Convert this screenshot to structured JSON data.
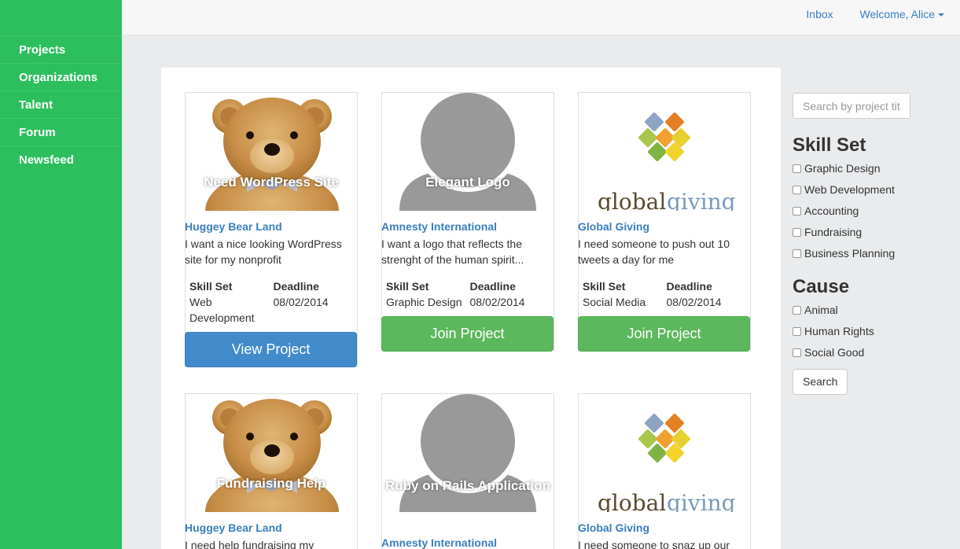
{
  "nav": {
    "items": [
      {
        "label": "Projects"
      },
      {
        "label": "Organizations"
      },
      {
        "label": "Talent"
      },
      {
        "label": "Forum"
      },
      {
        "label": "Newsfeed"
      }
    ]
  },
  "topbar": {
    "inbox": "Inbox",
    "welcome": "Welcome, Alice"
  },
  "projects": [
    {
      "title": "Need WordPress Site",
      "org": "Huggey Bear Land",
      "desc": "I want a nice looking WordPress site for my nonprofit",
      "skill_label": "Skill Set",
      "skill": "Web Development",
      "deadline_label": "Deadline",
      "deadline": "08/02/2014",
      "button": "View Project",
      "image": "teddy-bear"
    },
    {
      "title": "Elegant Logo",
      "org": "Amnesty International",
      "desc": "I want a logo that reflects the strenght of the human spirit...",
      "skill_label": "Skill Set",
      "skill": "Graphic Design",
      "deadline_label": "Deadline",
      "deadline": "08/02/2014",
      "button": "Join Project",
      "image": "avatar-placeholder"
    },
    {
      "title": "",
      "org": "Global Giving",
      "desc": "I need someone to push out 10 tweets a day for me",
      "skill_label": "Skill Set",
      "skill": "Social Media",
      "deadline_label": "Deadline",
      "deadline": "08/02/2014",
      "button": "Join Project",
      "image": "globalgiving-logo"
    },
    {
      "title": "Fundraising Help",
      "org": "Huggey Bear Land",
      "desc": "I need help fundraising my",
      "image": "teddy-bear"
    },
    {
      "title": "Ruby on Rails Application",
      "org": "Amnesty International",
      "desc": "",
      "image": "avatar-placeholder"
    },
    {
      "title": "",
      "org": "Global Giving",
      "desc": "I need someone to snaz up our",
      "image": "globalgiving-logo"
    }
  ],
  "filters": {
    "search_placeholder": "Search by project title",
    "skill_heading": "Skill Set",
    "skills": [
      "Graphic Design",
      "Web Development",
      "Accounting",
      "Fundraising",
      "Business Planning"
    ],
    "cause_heading": "Cause",
    "causes": [
      "Animal",
      "Human Rights",
      "Social Good"
    ],
    "search_button": "Search"
  },
  "logo_text": {
    "global": "global",
    "giving": "giving"
  },
  "colors": {
    "sidebar": "#2dbf5e",
    "link": "#3a7ebf",
    "view_button": "#428bca",
    "join_button": "#5cb85c"
  }
}
